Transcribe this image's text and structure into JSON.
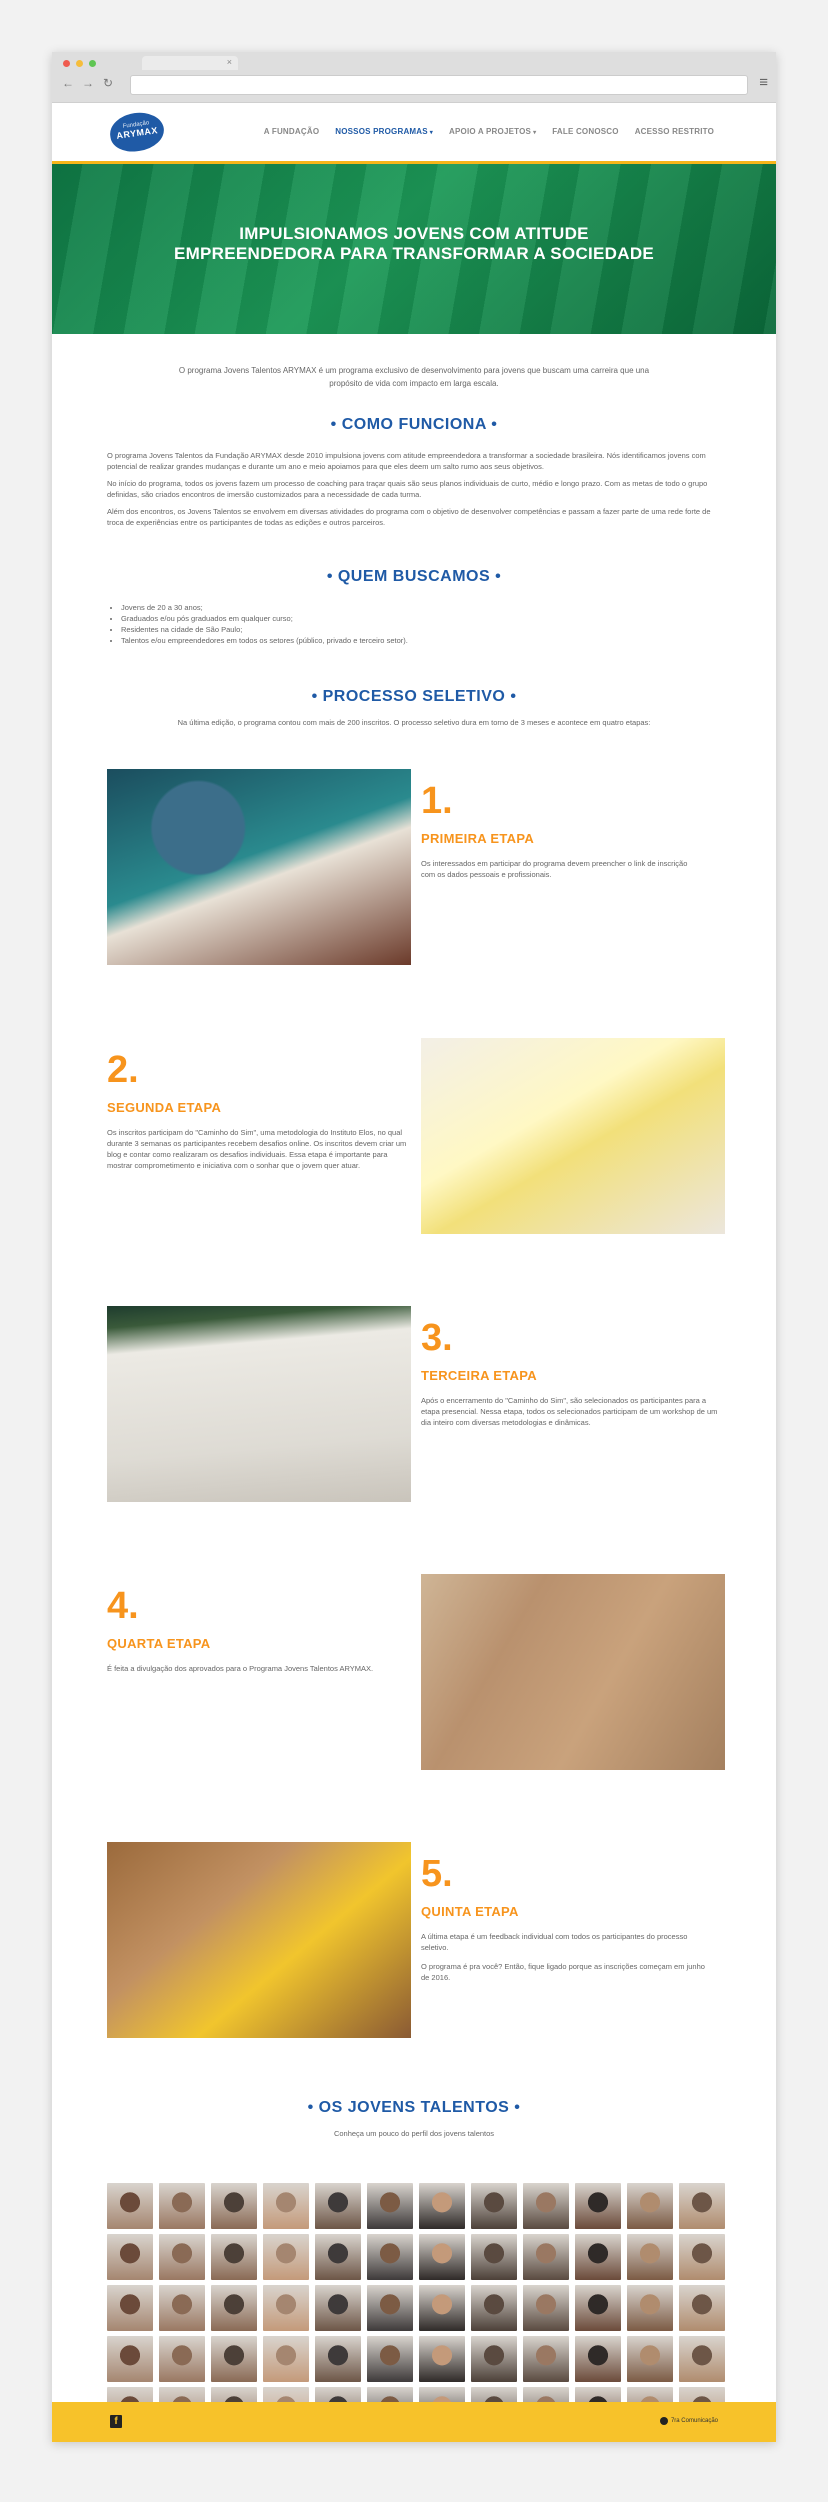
{
  "browser": {
    "tab_close": "×",
    "back": "←",
    "forward": "→",
    "reload": "↻",
    "menu": "≡"
  },
  "logo": {
    "small": "Fundação",
    "name": "ARYMAX"
  },
  "nav": {
    "items": [
      {
        "label": "A FUNDAÇÃO"
      },
      {
        "label": "NOSSOS PROGRAMAS",
        "caret": "▾"
      },
      {
        "label": "APOIO A PROJETOS",
        "caret": "▾"
      },
      {
        "label": "FALE CONOSCO"
      },
      {
        "label": "ACESSO RESTRITO"
      }
    ]
  },
  "hero": {
    "title": "IMPULSIONAMOS JOVENS COM ATITUDE EMPREENDEDORA PARA TRANSFORMAR A SOCIEDADE"
  },
  "intro": "O programa Jovens Talentos ARYMAX é um programa exclusivo de desenvolvimento para jovens que buscam uma carreira que una propósito de vida com impacto em larga escala.",
  "como_funciona": {
    "title": "• COMO FUNCIONA •",
    "paragraphs": [
      "O programa Jovens Talentos da Fundação ARYMAX desde 2010 impulsiona jovens com atitude empreendedora a transformar a sociedade brasileira. Nós identificamos jovens com potencial de realizar grandes mudanças e durante um ano e meio apoiamos para que eles deem um salto rumo aos seus objetivos.",
      "No início do programa, todos os jovens fazem um processo de coaching para traçar quais são seus planos individuais de curto, médio e longo prazo. Com as metas de todo o grupo definidas, são criados encontros de imersão customizados para a necessidade de cada turma.",
      "Além dos encontros, os Jovens Talentos se envolvem em diversas atividades do programa com o objetivo de desenvolver competências e passam a fazer parte de uma rede forte de troca de experiências entre os participantes de todas as edições e outros parceiros."
    ]
  },
  "quem_buscamos": {
    "title": "• QUEM BUSCAMOS •",
    "items": [
      "Jovens de 20 a 30 anos;",
      "Graduados e/ou pós graduados em qualquer curso;",
      "Residentes na cidade de São Paulo;",
      "Talentos e/ou empreendedores em todos os setores (público, privado e terceiro setor)."
    ]
  },
  "processo": {
    "title": "• PROCESSO SELETIVO •",
    "subtitle": "Na última edição, o programa contou com mais de 200 inscritos. O processo seletivo dura em torno de 3 meses e acontece em quatro etapas:",
    "steps": [
      {
        "num": "1.",
        "title": "PRIMEIRA ETAPA",
        "desc": [
          "Os interessados em participar do programa devem preencher o link de inscrição com os dados pessoais e profissionais."
        ]
      },
      {
        "num": "2.",
        "title": "SEGUNDA ETAPA",
        "desc": [
          "Os inscritos participam do \"Caminho do Sim\", uma metodologia do Instituto Elos, no qual durante 3 semanas os participantes recebem desafios online. Os inscritos devem criar um blog e contar como realizaram os desafios individuais. Essa etapa é importante para mostrar comprometimento e iniciativa com o sonhar que o jovem quer atuar."
        ]
      },
      {
        "num": "3.",
        "title": "TERCEIRA ETAPA",
        "desc": [
          "Após o encerramento do \"Caminho do Sim\", são selecionados os participantes para a etapa presencial. Nessa etapa, todos os selecionados participam de um workshop de um dia inteiro com diversas metodologias e dinâmicas."
        ]
      },
      {
        "num": "4.",
        "title": "QUARTA ETAPA",
        "desc": [
          "É feita a divulgação dos aprovados para o Programa Jovens Talentos ARYMAX."
        ]
      },
      {
        "num": "5.",
        "title": "QUINTA ETAPA",
        "desc": [
          "A última etapa é um feedback individual com todos os participantes do processo seletivo.",
          "O programa é pra você? Então, fique ligado porque as inscrições começam em junho de 2016."
        ]
      }
    ]
  },
  "jovens": {
    "title": "• OS JOVENS TALENTOS •",
    "subtitle": "Conheça um pouco do perfil dos jovens talentos",
    "photo_count": 60
  },
  "footer": {
    "facebook": "f",
    "credit": "7ra Comunicação"
  },
  "colors": {
    "brand_blue": "#1f5aa6",
    "orange": "#f7941d",
    "yellow": "#f7c22a",
    "hero_green": "#1d9a58"
  }
}
